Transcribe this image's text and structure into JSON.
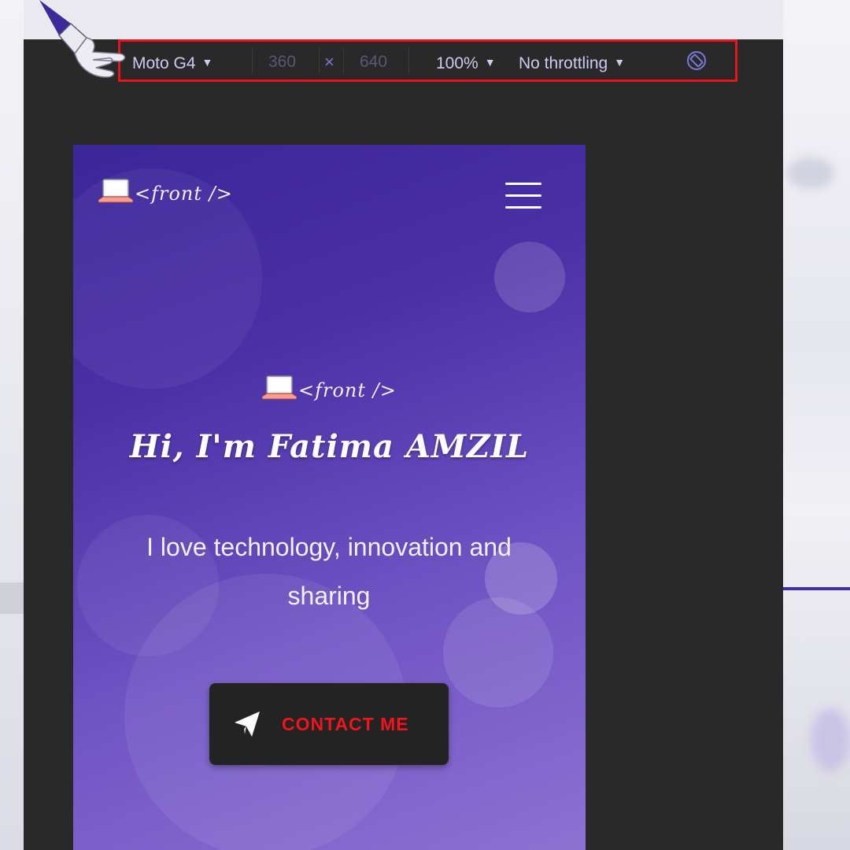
{
  "toolbar": {
    "device": "Moto G4",
    "width": "360",
    "times": "×",
    "height": "640",
    "zoom": "100%",
    "throttling": "No throttling",
    "dropdown_arrow": "▼"
  },
  "icons": {
    "rotate": "rotate-icon",
    "menu": "hamburger-menu-icon",
    "send": "paper-plane-icon",
    "logo": "laptop-icon",
    "cursor": "pointing-hand-icon"
  },
  "site": {
    "logo_text": "<front />",
    "title": "Hi, I'm Fatima AMZIL",
    "subtitle": "I love technology, innovation and sharing",
    "contact_label": "CONTACT ME"
  },
  "colors": {
    "toolbar_highlight": "#e8141c",
    "toolbar_text": "#c9ccf2",
    "hero_gradient_top": "#3b2698",
    "hero_gradient_bottom": "#8d71d2",
    "contact_text": "#f2141c",
    "contact_bg": "#232323"
  }
}
